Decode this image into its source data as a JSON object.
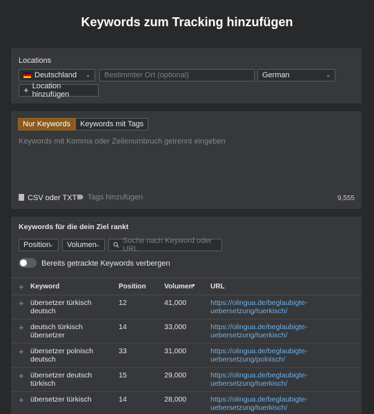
{
  "page": {
    "title": "Keywords zum Tracking hinzufügen"
  },
  "locations": {
    "label": "Locations",
    "country": "Deutschland",
    "place_placeholder": "Bestimmter Ort (optional)",
    "language": "German",
    "add_label": "Location hinzufügen"
  },
  "keywords": {
    "tab_active": "Nur Keywords",
    "tab_inactive": "Keywords mit Tags",
    "placeholder": "Keywords mit Komma oder Zeilenumbruch getrennt eingeben",
    "csv_label": "CSV oder TXT",
    "tags_label": "Tags hinzufügen",
    "count": "9,555"
  },
  "ranking": {
    "title": "Keywords für die dein Ziel rankt",
    "filter_position": "Position",
    "filter_volume": "Volumen",
    "search_placeholder": "Suche nach Keyword oder URL",
    "toggle_label": "Bereits getrackte Keywords verbergen",
    "columns": {
      "keyword": "Keyword",
      "position": "Position",
      "volume": "Volumen",
      "url": "URL"
    },
    "rows": [
      {
        "keyword": "übersetzer türkisch deutsch",
        "position": "12",
        "volume": "41,000",
        "url": "https://olingua.de/beglaubigte-uebersetzung/tuerkisch/"
      },
      {
        "keyword": "deutsch türkisch übersetzer",
        "position": "14",
        "volume": "33,000",
        "url": "https://olingua.de/beglaubigte-uebersetzung/tuerkisch/"
      },
      {
        "keyword": "übersetzer polnisch deutsch",
        "position": "33",
        "volume": "31,000",
        "url": "https://olingua.de/beglaubigte-uebersetzung/polnisch/"
      },
      {
        "keyword": "übersetzer deutsch türkisch",
        "position": "15",
        "volume": "29,000",
        "url": "https://olingua.de/beglaubigte-uebersetzung/tuerkisch/"
      },
      {
        "keyword": "übersetzer türkisch",
        "position": "14",
        "volume": "28,000",
        "url": "https://olingua.de/beglaubigte-uebersetzung/tuerkisch/"
      }
    ]
  },
  "colors": {
    "accent": "#8a5a1f",
    "link": "#6fb0e8",
    "background": "#28292b",
    "card": "#36383b"
  },
  "icons": {
    "add": "plus-icon",
    "file": "file-icon",
    "tag": "tag-icon",
    "search": "search-icon",
    "chevron": "chevron-down-icon",
    "sort": "sort-desc-icon"
  }
}
